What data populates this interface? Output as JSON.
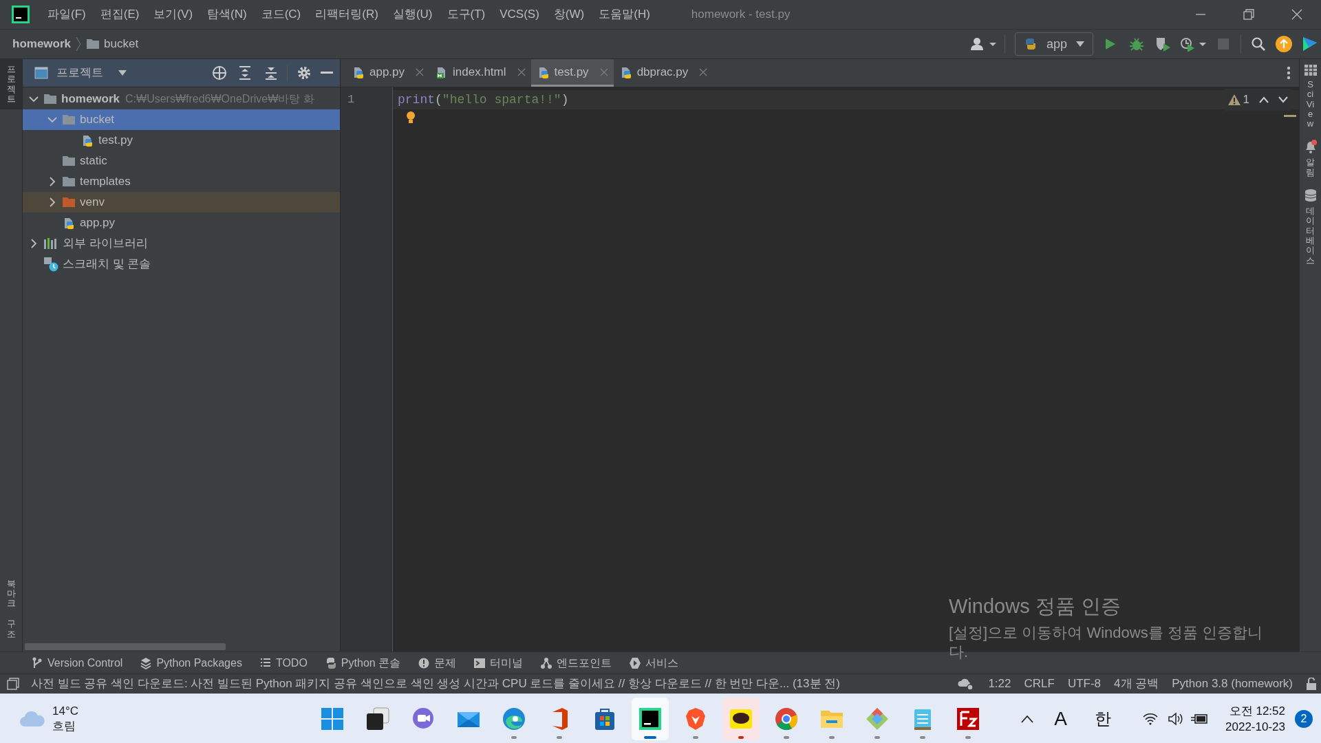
{
  "window": {
    "title": "homework - test.py"
  },
  "menu": [
    "파일(F)",
    "편집(E)",
    "보기(V)",
    "탐색(N)",
    "코드(C)",
    "리팩터링(R)",
    "실행(U)",
    "도구(T)",
    "VCS(S)",
    "창(W)",
    "도움말(H)"
  ],
  "breadcrumb": [
    "homework",
    "bucket"
  ],
  "run_config": "app",
  "left_strip": [
    {
      "label": "프로젝트",
      "selected": true
    },
    {
      "label": "북마크",
      "selected": false
    },
    {
      "label": "구조",
      "selected": false
    }
  ],
  "right_strip": [
    "SciView",
    "알림",
    "데이터베이스"
  ],
  "project_panel": {
    "title": "프로젝트",
    "tree": [
      {
        "label": "homework",
        "path": "C:₩Users₩fred6₩OneDrive₩바탕 화",
        "kind": "folder",
        "expanded": true,
        "selected": false,
        "children": [
          {
            "label": "bucket",
            "kind": "folder",
            "expanded": true,
            "selected": true,
            "children": [
              {
                "label": "test.py",
                "kind": "python",
                "selected": false
              }
            ]
          },
          {
            "label": "static",
            "kind": "folder",
            "selected": false
          },
          {
            "label": "templates",
            "kind": "folder",
            "expanded": false,
            "selected": false
          },
          {
            "label": "venv",
            "kind": "excluded",
            "expanded": false,
            "selected": false
          },
          {
            "label": "app.py",
            "kind": "python",
            "selected": false
          }
        ]
      },
      {
        "label": "외부 라이브러리",
        "kind": "library",
        "expanded": false,
        "selected": false
      },
      {
        "label": "스크래치 및 콘솔",
        "kind": "scratch",
        "selected": false
      }
    ]
  },
  "tabs": [
    {
      "label": "app.py",
      "kind": "python",
      "selected": false
    },
    {
      "label": "index.html",
      "kind": "html",
      "selected": false
    },
    {
      "label": "test.py",
      "kind": "python",
      "selected": true
    },
    {
      "label": "dbprac.py",
      "kind": "python",
      "selected": false
    }
  ],
  "editor": {
    "warnings": "1",
    "lines": [
      {
        "number": "1",
        "tokens": [
          {
            "text": "print",
            "kind": "builtin"
          },
          {
            "text": "(",
            "kind": "plain"
          },
          {
            "text": "\"hello sparta!!\"",
            "kind": "string"
          },
          {
            "text": ")",
            "kind": "plain"
          }
        ]
      }
    ]
  },
  "tool_windows": [
    {
      "label": "Version Control",
      "kind": "vcs"
    },
    {
      "label": "Python Packages",
      "kind": "packages"
    },
    {
      "label": "TODO",
      "kind": "todo"
    },
    {
      "label": "Python 콘솔",
      "kind": "python"
    },
    {
      "label": "문제",
      "kind": "problems"
    },
    {
      "label": "터미널",
      "kind": "terminal"
    },
    {
      "label": "엔드포인트",
      "kind": "endpoints"
    },
    {
      "label": "서비스",
      "kind": "services"
    }
  ],
  "status_bar": {
    "message": "사전 빌드 공유 색인 다운로드: 사전 빌드된 Python 패키지 공유 색인으로 색인 생성 시간과 CPU 로드를 줄이세요 // 항상 다운로드 // 한 번만 다운... (13분 전)",
    "items": [
      "1:22",
      "CRLF",
      "UTF-8",
      "4개 공백",
      "Python 3.8 (homework)"
    ]
  },
  "activation": {
    "title": "Windows 정품 인증",
    "body": "[설정]으로 이동하여 Windows를 정품 인증합니다."
  },
  "taskbar": {
    "weather": {
      "temperature": "14°C",
      "condition": "흐림"
    },
    "apps": [
      {
        "kind": "start",
        "running": false,
        "selected": false,
        "attention": false
      },
      {
        "kind": "taskview",
        "running": false,
        "selected": false,
        "attention": false
      },
      {
        "kind": "chat",
        "running": false,
        "selected": false,
        "attention": false
      },
      {
        "kind": "mail",
        "running": false,
        "selected": false,
        "attention": false
      },
      {
        "kind": "edge",
        "running": true,
        "selected": false,
        "attention": false
      },
      {
        "kind": "office",
        "running": true,
        "selected": false,
        "attention": false
      },
      {
        "kind": "store",
        "running": false,
        "selected": false,
        "attention": false
      },
      {
        "kind": "pycharm",
        "running": true,
        "selected": true,
        "attention": false
      },
      {
        "kind": "brave",
        "running": true,
        "selected": false,
        "attention": false
      },
      {
        "kind": "talk",
        "running": true,
        "selected": false,
        "attention": true
      },
      {
        "kind": "chrome",
        "running": true,
        "selected": false,
        "attention": false
      },
      {
        "kind": "explorer",
        "running": true,
        "selected": false,
        "attention": false
      },
      {
        "kind": "diamond",
        "running": true,
        "selected": false,
        "attention": false
      },
      {
        "kind": "notepad",
        "running": true,
        "selected": false,
        "attention": false
      },
      {
        "kind": "filezilla",
        "running": true,
        "selected": false,
        "attention": false
      }
    ],
    "tray": {
      "input_mode": "A",
      "language": "한",
      "time": "오전 12:52",
      "date": "2022-10-23",
      "notifications": "2"
    }
  }
}
